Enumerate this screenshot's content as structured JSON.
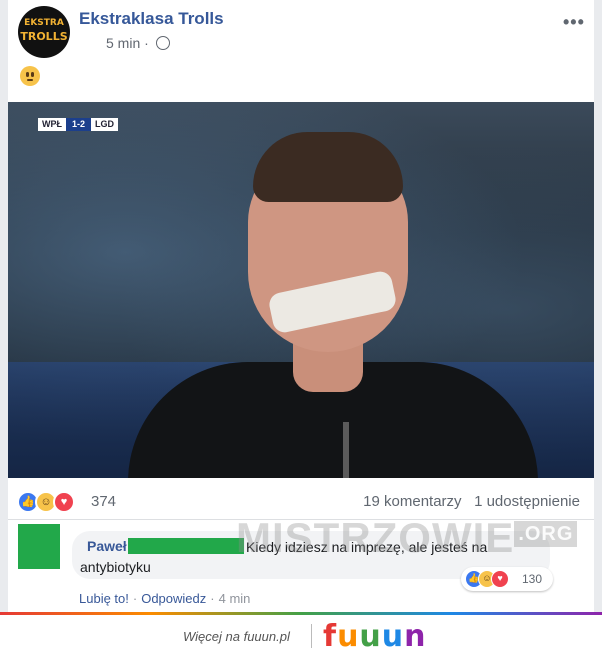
{
  "post": {
    "page_name": "Ekstraklasa Trolls",
    "time": "5 min",
    "separator": "·",
    "avatar_logo": {
      "line1": "EKSTRA",
      "line2": "TROLLS"
    },
    "icons": {
      "privacy": "globe-icon",
      "menu": "more-options-icon",
      "status": "slightly-smiling-face-emoji"
    }
  },
  "photo": {
    "scoreboard": {
      "home": "WPŁ",
      "score": "1-2",
      "away": "LGD"
    }
  },
  "reactions": {
    "count": "374",
    "comments": "19 komentarzy",
    "shares": "1 udostępnienie",
    "types": [
      "like",
      "haha",
      "love"
    ]
  },
  "comment": {
    "author": "Paweł",
    "text_line1": "Kiedy idziesz na imprezę, ale jesteś na",
    "text_line2": "antybiotyku",
    "reaction_count": "130",
    "like_label": "Lubię to!",
    "reply_label": "Odpowiedz",
    "time": "4 min",
    "dot": "·"
  },
  "watermark": {
    "text": "MISTRZOWIE",
    "suffix": ".ORG"
  },
  "footer": {
    "more_text": "Więcej na fuuun.pl",
    "brand": {
      "f": "f",
      "u1": "u",
      "u2": "u",
      "u3": "u",
      "n": "n"
    }
  },
  "colors": {
    "link_blue": "#365899",
    "censor_green": "#22a84a",
    "like_blue": "#3b78f0",
    "love_red": "#f0424f",
    "haha_yellow": "#f7c34a"
  }
}
